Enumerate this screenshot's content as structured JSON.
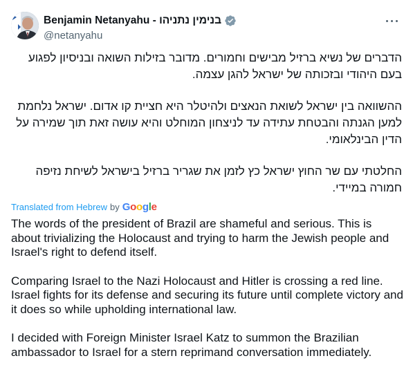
{
  "author": {
    "name": "Benjamin Netanyahu - בנימין נתניהו",
    "handle": "@netanyahu",
    "verified_color": "#829aab"
  },
  "hebrew_paragraphs": [
    "הדברים של נשיא ברזיל מבישים וחמורים. מדובר בזילות השואה ובניסיון לפגוע בעם היהודי ובזכותה של ישראל להגן עצמה.",
    "ההשוואה בין ישראל לשואת הנאצים ולהיטלר היא חציית קו אדום. ישראל נלחמת למען הגנתה והבטחת עתידה עד לניצחון המוחלט והיא עושה זאת תוך שמירה על הדין הבינלאומי.",
    "החלטתי עם שר החוץ ישראל כץ לזמן את שגריר ברזיל בישראל לשיחת נזיפה חמורה במיידי."
  ],
  "translation": {
    "label": "Translated from Hebrew",
    "by": "by",
    "provider": "Google"
  },
  "english_paragraphs": [
    "The words of the president of Brazil are shameful and serious. This is about trivializing the Holocaust and trying to harm the Jewish people and Israel's right to defend itself.",
    "Comparing Israel to the Nazi Holocaust and Hitler is crossing a red line. Israel fights for its defense and securing its future until complete victory and it does so while upholding international law.",
    "I decided with Foreign Minister Israel Katz to summon the Brazilian ambassador to Israel for a stern reprimand conversation immediately."
  ],
  "icons": {
    "verified": "verified-badge-icon",
    "more": "more-options-icon"
  }
}
